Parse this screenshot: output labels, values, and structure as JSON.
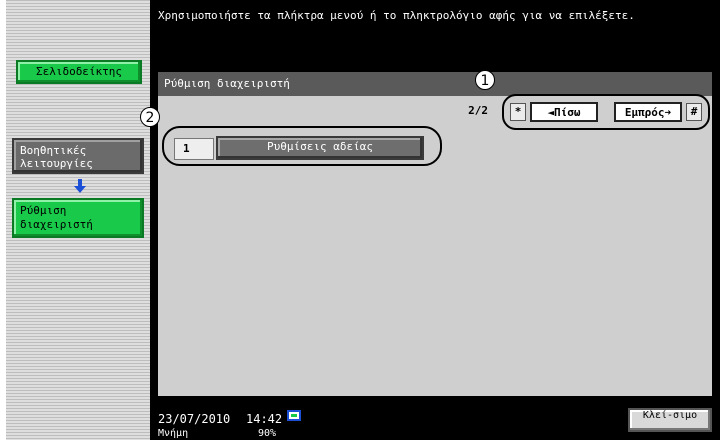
{
  "header": {
    "instruction": "Χρησιμοποιήστε τα πλήκτρα μενού ή το πληκτρολόγιο αφής για να επιλέξετε."
  },
  "sidebar": {
    "bookmark_label": "Σελιδοδείκτης",
    "breadcrumb_parent": "Βοηθητικές λειτουργίες",
    "breadcrumb_current": "Ρύθμιση διαχειριστή"
  },
  "panel": {
    "title": "Ρύθμιση διαχειριστή",
    "page_indicator": "2/2",
    "star_key": "*",
    "back_label": "◄Πίσω",
    "forward_label": "Εμπρός➜",
    "hash_key": "#"
  },
  "items": [
    {
      "number": "1",
      "label": "Ρυθμίσεις αδείας"
    }
  ],
  "callouts": {
    "one": "1",
    "two": "2"
  },
  "footer": {
    "date": "23/07/2010",
    "time": "14:42",
    "memory_label": "Μνήμη",
    "memory_value": "90%",
    "close_label": "Κλεί-σιμο"
  },
  "colors": {
    "accent_green": "#19c94a",
    "arrow_blue": "#1a4fd6"
  }
}
